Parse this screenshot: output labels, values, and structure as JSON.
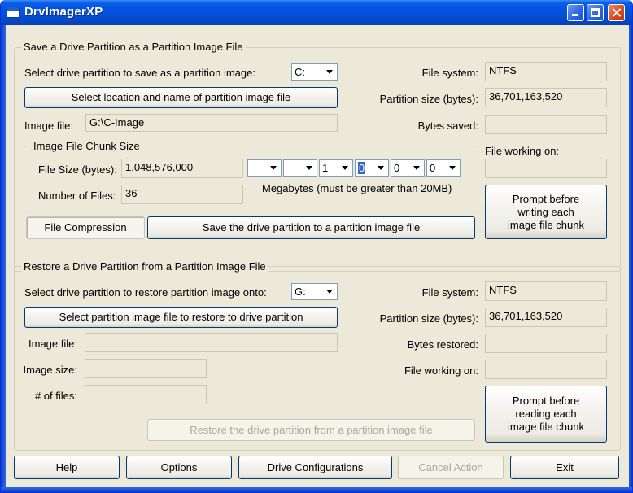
{
  "window": {
    "title": "DrvImagerXP"
  },
  "save": {
    "group_title": "Save a Drive Partition as a Partition Image File",
    "select_label": "Select drive partition to save as a partition image:",
    "drive_value": "C:",
    "select_location_button": "Select location and name of partition image file",
    "image_file_label": "Image file:",
    "image_file_value": "G:\\C-Image",
    "fs_label": "File system:",
    "fs_value": "NTFS",
    "psize_label": "Partition size (bytes):",
    "psize_value": "36,701,163,520",
    "bytes_saved_label": "Bytes saved:",
    "bytes_saved_value": "",
    "file_working_label": "File working on:",
    "file_working_value": "",
    "prompt_button": [
      "Prompt before",
      "writing each",
      "image file chunk"
    ],
    "chunk": {
      "title": "Image File Chunk Size",
      "file_size_label": "File Size (bytes):",
      "file_size_value": "1,048,576,000",
      "num_files_label": "Number of Files:",
      "num_files_value": "36",
      "digits": [
        "",
        "",
        "1",
        "0",
        "0",
        "0"
      ],
      "megabytes_note": "Megabytes (must be greater than 20MB)"
    },
    "compression_button": "File Compression",
    "save_button": "Save the drive partition to a partition image file"
  },
  "restore": {
    "group_title": "Restore a Drive Partition from a Partition Image File",
    "select_label": "Select drive partition to restore partition image onto:",
    "drive_value": "G:",
    "select_file_button": "Select partition image file to restore to drive partition",
    "image_file_label": "Image file:",
    "image_file_value": "",
    "image_size_label": "Image size:",
    "image_size_value": "",
    "num_files_label": "# of files:",
    "num_files_value": "",
    "fs_label": "File system:",
    "fs_value": "NTFS",
    "psize_label": "Partition size (bytes):",
    "psize_value": "36,701,163,520",
    "bytes_restored_label": "Bytes restored:",
    "bytes_restored_value": "",
    "file_working_label": "File working on:",
    "file_working_value": "",
    "prompt_button": [
      "Prompt before",
      "reading each",
      "image file chunk"
    ],
    "restore_button": "Restore the drive partition from a partition image file"
  },
  "footer": {
    "help": "Help",
    "options": "Options",
    "drive_config": "Drive Configurations",
    "cancel": "Cancel Action",
    "exit": "Exit"
  }
}
